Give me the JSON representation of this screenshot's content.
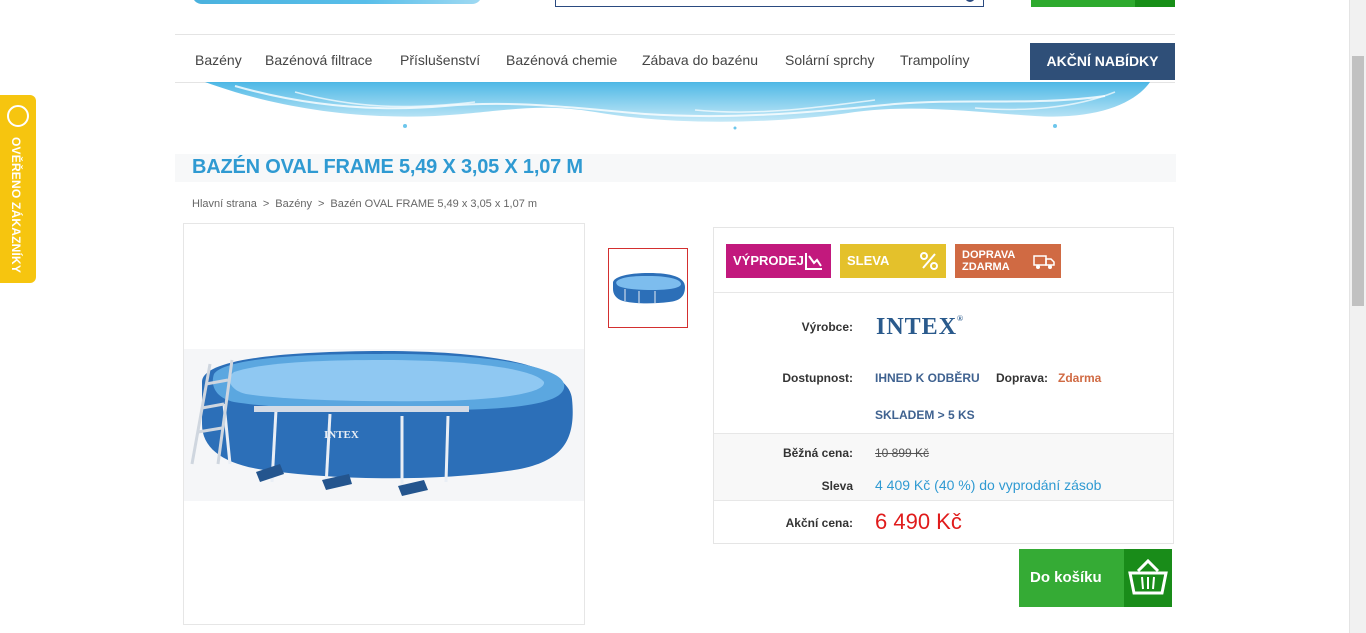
{
  "header": {
    "logo_alt": "logo"
  },
  "nav": {
    "items": [
      "Bazény",
      "Bazénová filtrace",
      "Příslušenství",
      "Bazénová chemie",
      "Zábava do bazénu",
      "Solární sprchy",
      "Trampolíny"
    ],
    "promo": "AKČNÍ NABÍDKY"
  },
  "product": {
    "title": "BAZÉN OVAL FRAME 5,49 X 3,05 X 1,07 M",
    "image_logo": "INTEX"
  },
  "breadcrumb": [
    "Hlavní strana",
    "Bazény",
    "Bazén OVAL FRAME 5,49 x 3,05 x 1,07 m"
  ],
  "badges": {
    "sale": "VÝPRODEJ",
    "discount": "SLEVA",
    "shipping": "DOPRAVA\nZDARMA"
  },
  "details": {
    "manufacturer_label": "Výrobce:",
    "manufacturer_name": "INTEX",
    "availability_label": "Dostupnost:",
    "availability_value": "IHNED K ODBĚRU",
    "shipping_label": "Doprava:",
    "shipping_value": "Zdarma",
    "stock_value": "SKLADEM > 5 KS",
    "regular_price_label": "Běžná cena:",
    "regular_price_value": "10 899 Kč",
    "discount_label": "Sleva",
    "discount_value": "4 409 Kč (40 %) do vyprodání zásob",
    "action_price_label": "Akční cena:",
    "action_price_value": "6 490 Kč"
  },
  "cart": {
    "add_label": "Do košíku"
  },
  "side_badge": {
    "text": "OVĚŘENO ZÁKAZNÍKY"
  },
  "colors": {
    "brand_blue": "#2f9ad2",
    "nav_promo": "#2f4f78",
    "sale_magenta": "#c2197d",
    "discount_yellow": "#e4c12b",
    "shipping_orange": "#d06a43",
    "cart_green": "#35ab35",
    "price_red": "#e01b1b"
  }
}
